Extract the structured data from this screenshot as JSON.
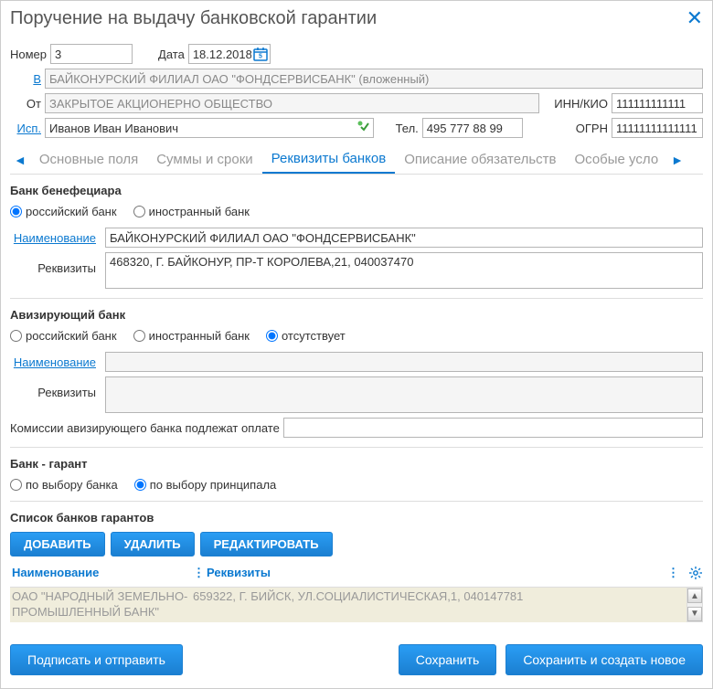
{
  "title": "Поручение на выдачу банковской гарантии",
  "labels": {
    "number": "Номер",
    "date": "Дата",
    "in": "В",
    "from": "От",
    "executor": "Исп.",
    "tel": "Тел.",
    "inn": "ИНН/КИО",
    "ogrn": "ОГРН",
    "name": "Наименование",
    "requisites": "Реквизиты",
    "commission": "Комиссии авизирующего банка подлежат оплате"
  },
  "values": {
    "number": "3",
    "date": "18.12.2018",
    "bank_in": "БАЙКОНУРСКИЙ ФИЛИАЛ ОАО \"ФОНДСЕРВИСБАНК\" (вложенный)",
    "from": "ЗАКРЫТОЕ АКЦИОНЕРНО ОБЩЕСТВО",
    "executor": "Иванов Иван Иванович",
    "tel": "495 777 88 99",
    "inn": "111111111111",
    "ogrn": "11111111111111",
    "benef_name": "БАЙКОНУРСКИЙ ФИЛИАЛ ОАО \"ФОНДСЕРВИСБАНК\"",
    "benef_req": "468320, Г. БАЙКОНУР, ПР-Т КОРОЛЕВА,21, 040037470",
    "aviz_name": "",
    "aviz_req": "",
    "commission": ""
  },
  "tabs": [
    "Основные поля",
    "Суммы и сроки",
    "Реквизиты банков",
    "Описание обязательств",
    "Особые усло"
  ],
  "sections": {
    "beneficiary": "Банк бенефециара",
    "advising": "Авизирующий банк",
    "guarantor": "Банк - гарант",
    "guarantor_list": "Список банков гарантов"
  },
  "radios": {
    "russian": "российский банк",
    "foreign": "иностранный банк",
    "none": "отсутствует",
    "by_bank": "по выбору банка",
    "by_principal": "по выбору принципала"
  },
  "buttons": {
    "add": "ДОБАВИТЬ",
    "delete": "УДАЛИТЬ",
    "edit": "РЕДАКТИРОВАТЬ",
    "sign_send": "Подписать и отправить",
    "save": "Сохранить",
    "save_new": "Сохранить и создать новое"
  },
  "grid": {
    "col_name": "Наименование",
    "col_req": "Реквизиты",
    "row1_name": "ОАО \"НАРОДНЫЙ ЗЕМЕЛЬНО-ПРОМЫШЛЕННЫЙ БАНК\"",
    "row1_req": "659322, Г. БИЙСК, УЛ.СОЦИАЛИСТИЧЕСКАЯ,1, 040147781"
  }
}
